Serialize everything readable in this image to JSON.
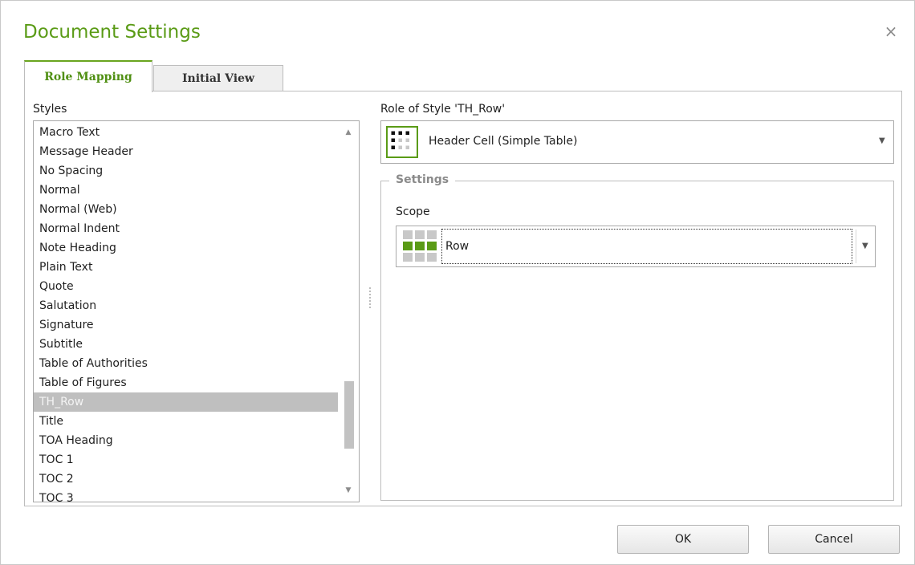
{
  "dialog": {
    "title": "Document Settings",
    "close_glyph": "×"
  },
  "tabs": [
    {
      "label": "Role Mapping",
      "active": true
    },
    {
      "label": "Initial View",
      "active": false
    }
  ],
  "styles": {
    "label": "Styles",
    "items": [
      "Macro Text",
      "Message Header",
      "No Spacing",
      "Normal",
      "Normal (Web)",
      "Normal Indent",
      "Note Heading",
      "Plain Text",
      "Quote",
      "Salutation",
      "Signature",
      "Subtitle",
      "Table of Authorities",
      "Table of Figures",
      "TH_Row",
      "Title",
      "TOA Heading",
      "TOC 1",
      "TOC 2",
      "TOC 3"
    ],
    "selected": "TH_Row"
  },
  "role": {
    "label": "Role of Style 'TH_Row'",
    "value": "Header Cell (Simple Table)",
    "icon": "table-header-cell-icon"
  },
  "settings": {
    "legend": "Settings",
    "scope_label": "Scope",
    "scope_value": "Row",
    "scope_icon": "table-row-scope-icon"
  },
  "buttons": {
    "ok": "OK",
    "cancel": "Cancel"
  },
  "colors": {
    "accent": "#5a9b16",
    "selection": "#bfbfbf"
  }
}
